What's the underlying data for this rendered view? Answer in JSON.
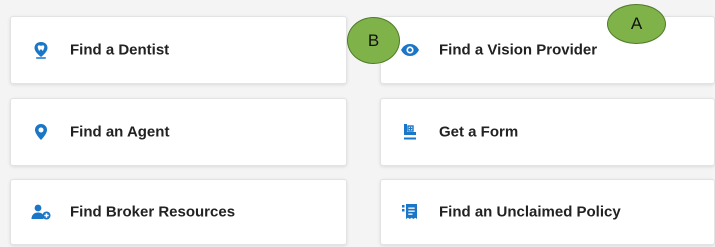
{
  "cards": [
    {
      "label": "Find a Dentist",
      "icon": "tooth-pin-icon"
    },
    {
      "label": "Find a Vision Provider",
      "icon": "eye-icon"
    },
    {
      "label": "Find an Agent",
      "icon": "location-pin-icon"
    },
    {
      "label": "Get a Form",
      "icon": "form-document-icon"
    },
    {
      "label": "Find Broker Resources",
      "icon": "user-add-icon"
    },
    {
      "label": "Find an Unclaimed Policy",
      "icon": "receipt-icon"
    }
  ],
  "markers": {
    "a": "A",
    "b": "B"
  },
  "colors": {
    "icon_blue": "#1a76c6",
    "marker_green": "#7fb34a",
    "background": "#f4f4f4"
  }
}
